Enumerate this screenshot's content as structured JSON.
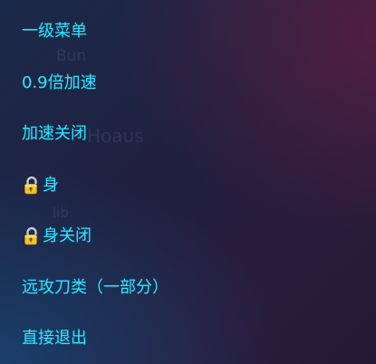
{
  "menu": {
    "items": [
      {
        "label": "一级菜单"
      },
      {
        "label": "0.9倍加速"
      },
      {
        "label": "加速关闭"
      },
      {
        "label": "身",
        "icon": "lock-icon"
      },
      {
        "label": "身关闭",
        "icon": "lock-icon"
      },
      {
        "label": "远攻刀类（一部分）"
      },
      {
        "label": "直接退出"
      }
    ]
  },
  "background_text": {
    "a": "Bun",
    "b": "Hoaus",
    "c": "lib"
  },
  "colors": {
    "item_text": "#2fe3ff",
    "lock_body": "#f2c230",
    "lock_shackle": "#c9ccd3"
  }
}
